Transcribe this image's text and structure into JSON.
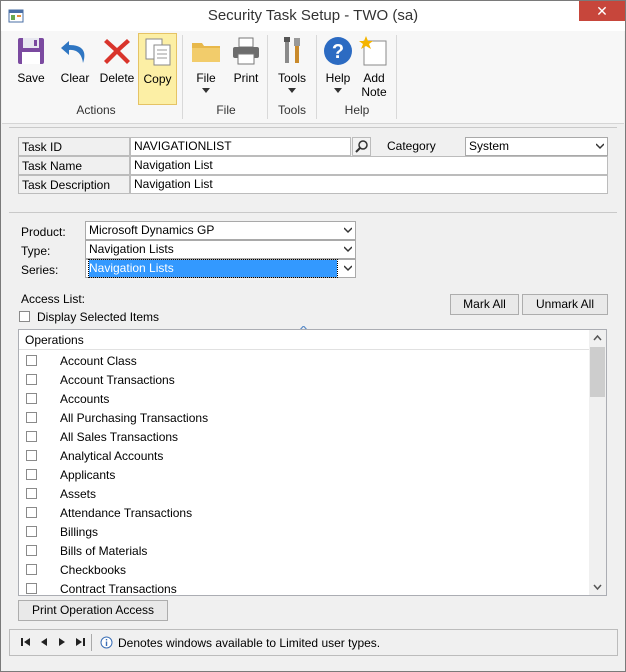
{
  "window": {
    "title": "Security Task Setup  -  TWO (sa)",
    "close": "✕"
  },
  "ribbon": {
    "buttons": {
      "save": "Save",
      "clear": "Clear",
      "delete": "Delete",
      "copy": "Copy",
      "file": "File",
      "print": "Print",
      "tools": "Tools",
      "help": "Help",
      "add_note": "Add Note"
    },
    "groups": {
      "actions": "Actions",
      "file": "File",
      "tools": "Tools",
      "help": "Help"
    }
  },
  "header": {
    "task_id_label": "Task ID",
    "task_id_value": "NAVIGATIONLIST",
    "category_label": "Category",
    "category_value": "System",
    "task_name_label": "Task Name",
    "task_name_value": "Navigation List",
    "task_desc_label": "Task Description",
    "task_desc_value": "Navigation List"
  },
  "filters": {
    "product_label": "Product:",
    "product_value": "Microsoft Dynamics GP",
    "type_label": "Type:",
    "type_value": "Navigation Lists",
    "series_label": "Series:",
    "series_value": "Navigation Lists"
  },
  "access": {
    "title": "Access List:",
    "display_selected": "Display Selected Items",
    "mark_all": "Mark All",
    "unmark_all": "Unmark All",
    "column": "Operations",
    "rows": [
      "Account Class",
      "Account Transactions",
      "Accounts",
      "All Purchasing Transactions",
      "All Sales Transactions",
      "Analytical Accounts",
      "Applicants",
      "Assets",
      "Attendance Transactions",
      "Billings",
      "Bills of Materials",
      "Checkbooks",
      "Contract Transactions"
    ]
  },
  "print_button": "Print Operation Access",
  "status": {
    "note": "Denotes windows available to Limited user types."
  },
  "colors": {
    "accent": "#1e5aa8",
    "selection": "#3399ff",
    "active_button": "#fcefa5",
    "close": "#c7463b"
  }
}
